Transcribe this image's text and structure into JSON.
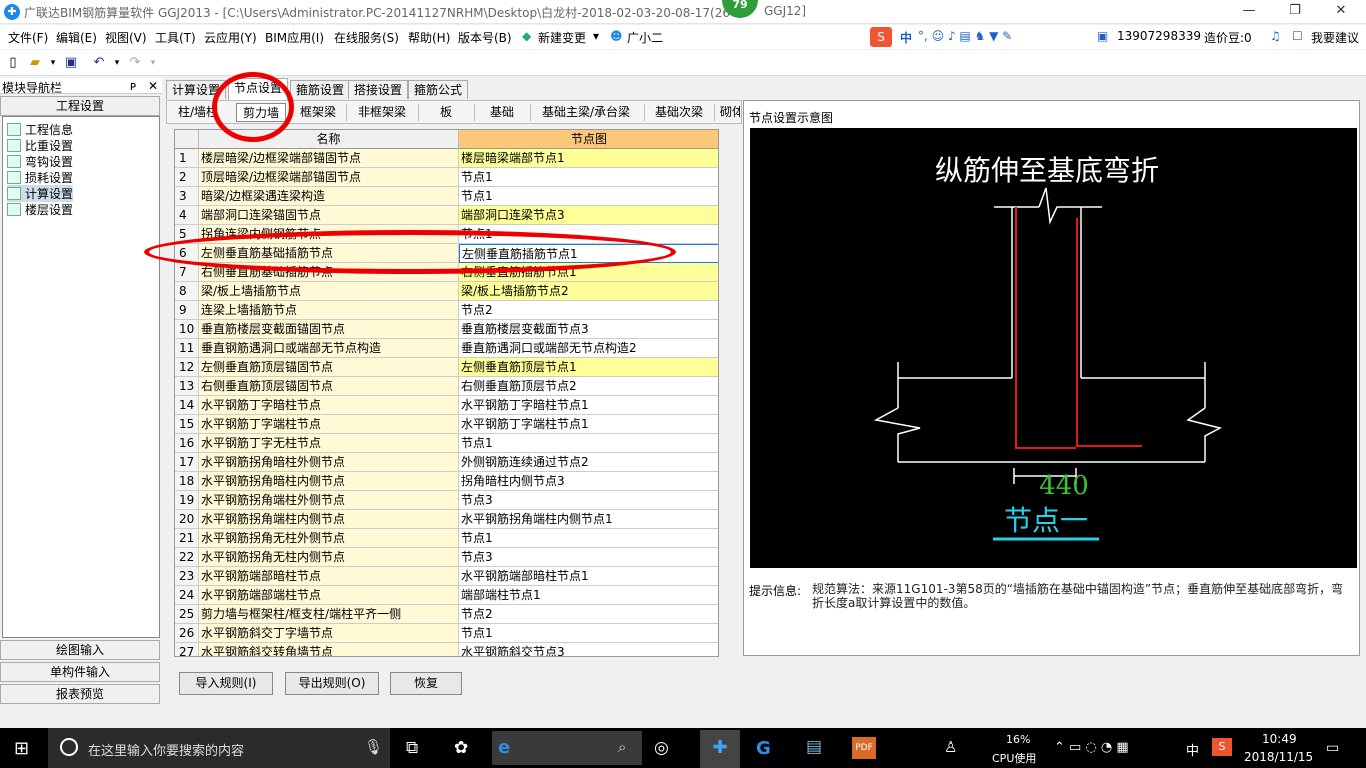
{
  "titlebar": {
    "title": "广联达BIM钢筋算量软件 GGJ2013 - [C:\\Users\\Administrator.PC-20141127NRHM\\Desktop\\白龙村-2018-02-03-20-08-17(26",
    "title_tail": "GGJ12]",
    "badge": "79",
    "minimize": "—",
    "maximize": "❐",
    "close": "✕"
  },
  "menubar": {
    "items": [
      "文件(F)",
      "编辑(E)",
      "视图(V)",
      "工具(T)",
      "云应用(Y)",
      "BIM应用(I)",
      "在线服务(S)",
      "帮助(H)",
      "版本号(B)",
      "新建变更",
      "广小二"
    ],
    "right": {
      "ime": "中",
      "phone": "13907298339",
      "cost": "造价豆:0",
      "suggest": "我要建议"
    }
  },
  "nav": {
    "title": "模块导航栏",
    "pin": "ᴘ",
    "close": "✕",
    "section": "工程设置",
    "items": [
      "工程信息",
      "比重设置",
      "弯钩设置",
      "损耗设置",
      "计算设置",
      "楼层设置"
    ],
    "bottom": [
      "绘图输入",
      "单构件输入",
      "报表预览"
    ]
  },
  "tabs": {
    "top": [
      "计算设置",
      "节点设置",
      "箍筋设置",
      "搭接设置",
      "箍筋公式"
    ],
    "sub": [
      "柱/墙柱",
      "剪力墙",
      "框架梁",
      "非框架梁",
      "板",
      "基础",
      "基础主梁/承台梁",
      "基础次梁",
      "砌体"
    ]
  },
  "grid": {
    "headers": [
      "名称",
      "节点图"
    ],
    "rows": [
      {
        "n": "1",
        "name": "楼层暗梁/边框梁端部锚固节点",
        "node": "楼层暗梁端部节点1",
        "hl": true
      },
      {
        "n": "2",
        "name": "顶层暗梁/边框梁端部锚固节点",
        "node": "节点1",
        "hl": false
      },
      {
        "n": "3",
        "name": "暗梁/边框梁遇连梁构造",
        "node": "节点1",
        "hl": false
      },
      {
        "n": "4",
        "name": "端部洞口连梁锚固节点",
        "node": "端部洞口连梁节点3",
        "hl": true
      },
      {
        "n": "5",
        "name": "拐角连梁内侧钢筋节点",
        "node": "节点1",
        "hl": false
      },
      {
        "n": "6",
        "name": "左侧垂直筋基础插筋节点",
        "node": "左侧垂直筋插筋节点1",
        "hl": false,
        "sel": true
      },
      {
        "n": "7",
        "name": "右侧垂直筋基础插筋节点",
        "node": "右侧垂直筋插筋节点1",
        "hl": true
      },
      {
        "n": "8",
        "name": "梁/板上墙插筋节点",
        "node": "梁/板上墙插筋节点2",
        "hl": true
      },
      {
        "n": "9",
        "name": "连梁上墙插筋节点",
        "node": "节点2",
        "hl": false
      },
      {
        "n": "10",
        "name": "垂直筋楼层变截面锚固节点",
        "node": "垂直筋楼层变截面节点3",
        "hl": false
      },
      {
        "n": "11",
        "name": "垂直钢筋遇洞口或端部无节点构造",
        "node": "垂直筋遇洞口或端部无节点构造2",
        "hl": false
      },
      {
        "n": "12",
        "name": "左侧垂直筋顶层锚固节点",
        "node": "左侧垂直筋顶层节点1",
        "hl": true
      },
      {
        "n": "13",
        "name": "右侧垂直筋顶层锚固节点",
        "node": "右侧垂直筋顶层节点2",
        "hl": false
      },
      {
        "n": "14",
        "name": "水平钢筋丁字暗柱节点",
        "node": "水平钢筋丁字暗柱节点1",
        "hl": false
      },
      {
        "n": "15",
        "name": "水平钢筋丁字端柱节点",
        "node": "水平钢筋丁字端柱节点1",
        "hl": false
      },
      {
        "n": "16",
        "name": "水平钢筋丁字无柱节点",
        "node": "节点1",
        "hl": false
      },
      {
        "n": "17",
        "name": "水平钢筋拐角暗柱外侧节点",
        "node": "外侧钢筋连续通过节点2",
        "hl": false
      },
      {
        "n": "18",
        "name": "水平钢筋拐角暗柱内侧节点",
        "node": "拐角暗柱内侧节点3",
        "hl": false
      },
      {
        "n": "19",
        "name": "水平钢筋拐角端柱外侧节点",
        "node": "节点3",
        "hl": false
      },
      {
        "n": "20",
        "name": "水平钢筋拐角端柱内侧节点",
        "node": "水平钢筋拐角端柱内侧节点1",
        "hl": false
      },
      {
        "n": "21",
        "name": "水平钢筋拐角无柱外侧节点",
        "node": "节点1",
        "hl": false
      },
      {
        "n": "22",
        "name": "水平钢筋拐角无柱内侧节点",
        "node": "节点3",
        "hl": false
      },
      {
        "n": "23",
        "name": "水平钢筋端部暗柱节点",
        "node": "水平钢筋端部暗柱节点1",
        "hl": false
      },
      {
        "n": "24",
        "name": "水平钢筋端部端柱节点",
        "node": "端部端柱节点1",
        "hl": false
      },
      {
        "n": "25",
        "name": "剪力墙与框架柱/框支柱/端柱平齐一侧",
        "node": "节点2",
        "hl": false
      },
      {
        "n": "26",
        "name": "水平钢筋斜交丁字墙节点",
        "node": "节点1",
        "hl": false
      },
      {
        "n": "27",
        "name": "水平钢筋斜交转角墙节点",
        "node": "水平钢筋斜交节点3",
        "hl": false
      }
    ]
  },
  "right": {
    "title": "节点设置示意图",
    "diagram_title": "纵筋伸至基底弯折",
    "dimension": "440",
    "node_label": "节点一",
    "hint_label": "提示信息:",
    "hint_text": "规范算法：来源11G101-3第58页的“墙插筋在基础中锚固构造”节点；垂直筋伸至基础底部弯折，弯折长度a取计算设置中的数值。"
  },
  "buttons": {
    "import": "导入规则(I)",
    "export": "导出规则(O)",
    "restore": "恢复"
  },
  "taskbar": {
    "search_placeholder": "在这里输入你要搜索的内容",
    "cpu_pct": "16%",
    "cpu_label": "CPU使用",
    "ime": "中",
    "time": "10:49",
    "date": "2018/11/15"
  },
  "colors": {
    "accent": "#1e88e5",
    "annotation": "#ee0000",
    "row_highlight": "#ffff99",
    "name_bg": "#fff9d6"
  }
}
